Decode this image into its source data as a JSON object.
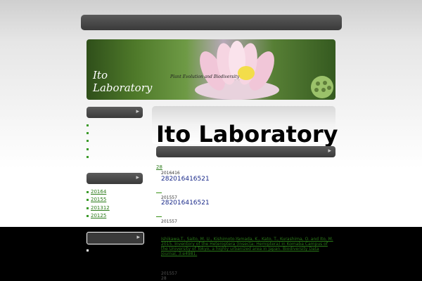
{
  "header": {
    "title": "Ito Laboratory",
    "subtitle": "Plant Evolution and Biodiversity"
  },
  "sidebar": {
    "chevron_icon": "▸",
    "links": [
      "20164",
      "20155",
      "201312",
      "20125"
    ]
  },
  "main": {
    "heading": "Ito Laboratory",
    "top_link": "28",
    "posts": [
      {
        "date": "2016416",
        "title": "282016416521"
      },
      {
        "date": "201557",
        "title": "282016416521"
      }
    ],
    "extra_date": "201557",
    "publication": "Ishikawa,T., Saito, M. U., Kishimoto-Yamada, K., Kato, T., Kurashima, O. and Ito, M. 2015. Inventory of the Heteroptera (Insecta: Hemiptera) in Komaba Campus of the University of Tokyo, a highly urbanized area in Japan. Biodiversity Data Journal, 3:e4981.",
    "pub_date": "201557",
    "pub_tail": "28"
  },
  "colors": {
    "accent_green": "#3a9218",
    "link_green": "#2a7a18",
    "post_blue": "#1a2a8a",
    "bar_dark": "#3a3a3a"
  }
}
